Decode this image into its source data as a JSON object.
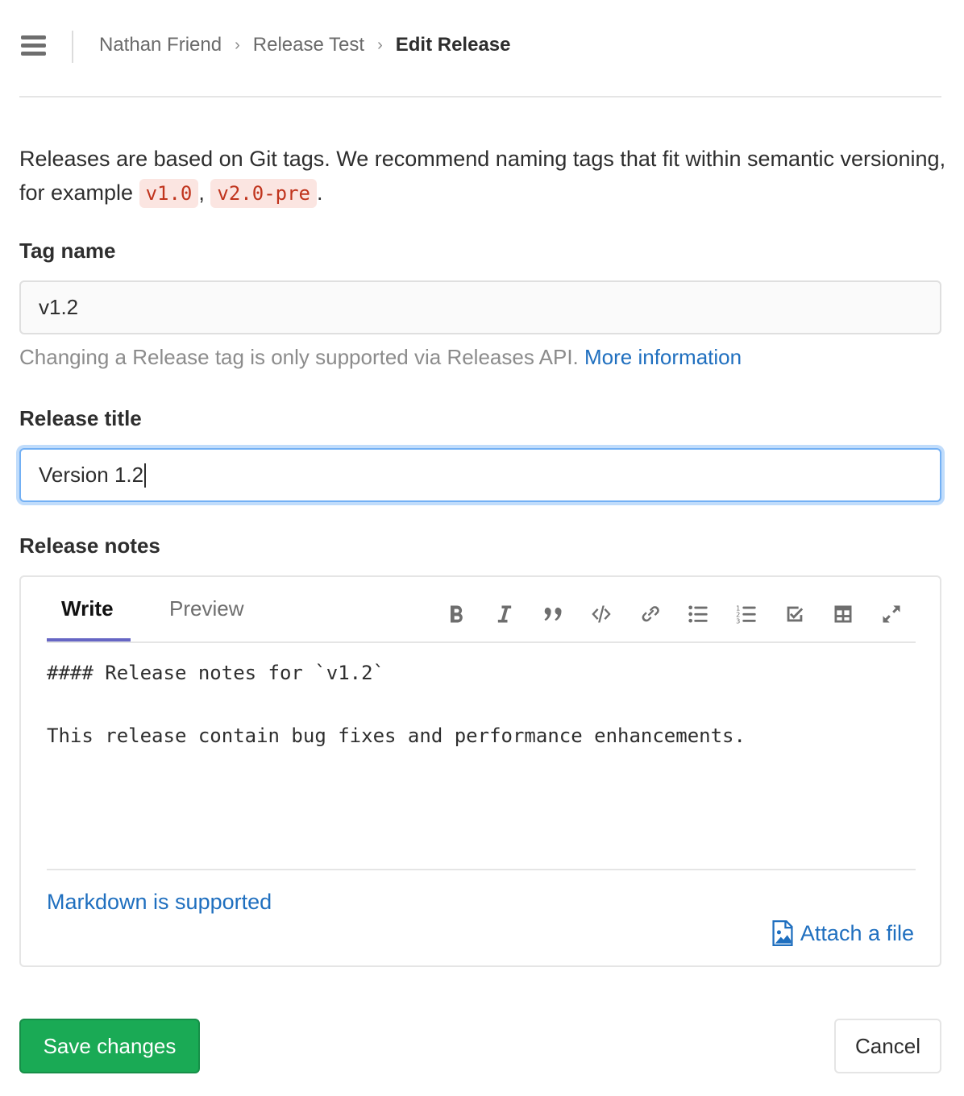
{
  "breadcrumb": {
    "items": [
      "Nathan Friend",
      "Release Test"
    ],
    "current": "Edit Release",
    "separator": "›"
  },
  "intro": {
    "text_before": "Releases are based on Git tags. We recommend naming tags that fit within semantic versioning, for example ",
    "example1": "v1.0",
    "comma": ", ",
    "example2": "v2.0-pre",
    "text_after": "."
  },
  "tag_name": {
    "label": "Tag name",
    "value": "v1.2",
    "help_text": "Changing a Release tag is only supported via Releases API.",
    "help_link": "More information"
  },
  "release_title": {
    "label": "Release title",
    "value": "Version 1.2"
  },
  "release_notes": {
    "label": "Release notes",
    "tabs": [
      {
        "label": "Write",
        "active": true
      },
      {
        "label": "Preview",
        "active": false
      }
    ],
    "toolbar": [
      "bold-icon",
      "italic-icon",
      "quote-icon",
      "code-icon",
      "link-icon",
      "bullet-list-icon",
      "numbered-list-icon",
      "task-list-icon",
      "table-icon",
      "fullscreen-icon"
    ],
    "content": "#### Release notes for `v1.2`\n\nThis release contain bug fixes and performance enhancements.",
    "markdown_link": "Markdown is supported",
    "attach_label": "Attach a file"
  },
  "actions": {
    "save_label": "Save changes",
    "cancel_label": "Cancel"
  },
  "colors": {
    "primary_button": "#1aaa55",
    "link": "#1f6fbf",
    "active_tab": "#6666c4",
    "focus_ring": "#73b0f4",
    "code_text": "#c0341d",
    "code_bg": "#fbe5e1"
  }
}
